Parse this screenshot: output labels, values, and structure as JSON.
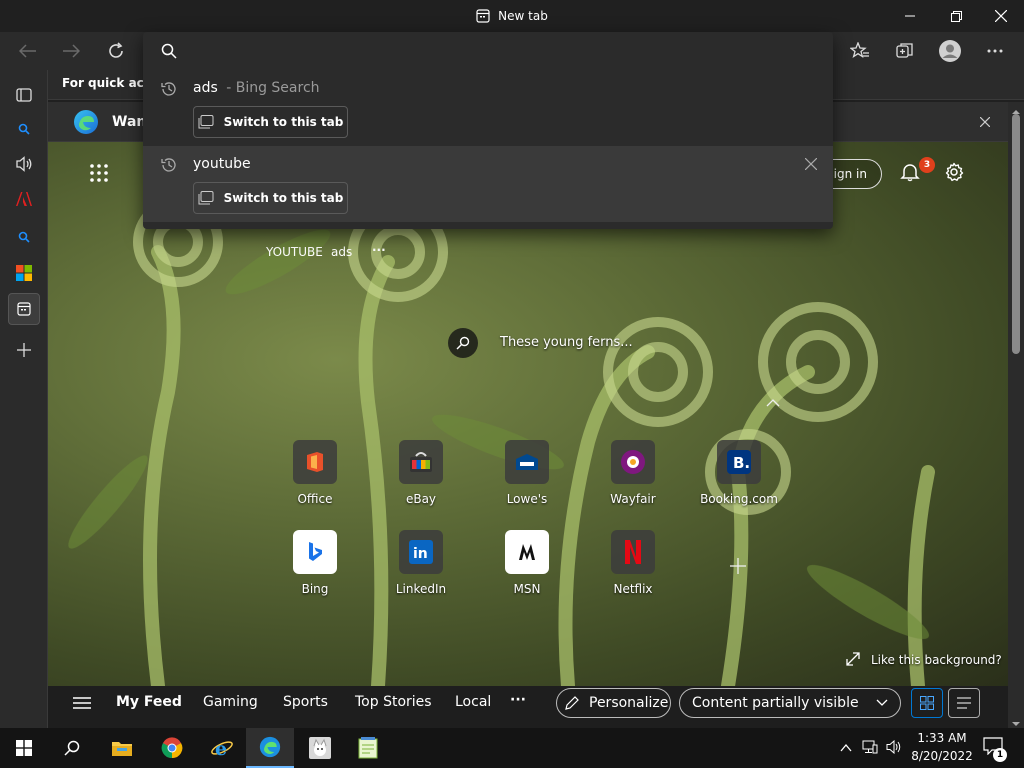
{
  "window": {
    "title": "New tab"
  },
  "favorites_bar": {
    "text": "For quick acces"
  },
  "notice": {
    "text": "Want"
  },
  "address_dropdown": {
    "suggestions": [
      {
        "text": "ads",
        "suffix": "- Bing Search",
        "action": "Switch to this tab"
      },
      {
        "text": "youtube",
        "action": "Switch to this tab"
      }
    ]
  },
  "header": {
    "sign_in": "Sign in",
    "notification_count": "3"
  },
  "quick_links_inline": [
    "YOUTUBE",
    "ads",
    "···"
  ],
  "image_info": {
    "caption": "These young ferns..."
  },
  "tiles": [
    {
      "label": "Office",
      "icon": "office-icon"
    },
    {
      "label": "eBay",
      "icon": "ebay-icon"
    },
    {
      "label": "Lowe's",
      "icon": "lowes-icon"
    },
    {
      "label": "Wayfair",
      "icon": "wayfair-icon"
    },
    {
      "label": "Booking.com",
      "icon": "booking-icon"
    },
    {
      "label": "Bing",
      "icon": "bing-icon"
    },
    {
      "label": "LinkedIn",
      "icon": "linkedin-icon"
    },
    {
      "label": "MSN",
      "icon": "msn-icon"
    },
    {
      "label": "Netflix",
      "icon": "netflix-icon"
    }
  ],
  "like_background": "Like this background?",
  "feed": {
    "tabs": [
      "My Feed",
      "Gaming",
      "Sports",
      "Top Stories",
      "Local"
    ],
    "more": "···",
    "personalize": "Personalize",
    "content_visibility": "Content partially visible"
  },
  "tray": {
    "time": "1:33 AM",
    "date": "8/20/2022",
    "notifications": "1"
  },
  "colors": {
    "accent": "#0078d4",
    "badge": "#e0401c",
    "background": "#202020"
  }
}
